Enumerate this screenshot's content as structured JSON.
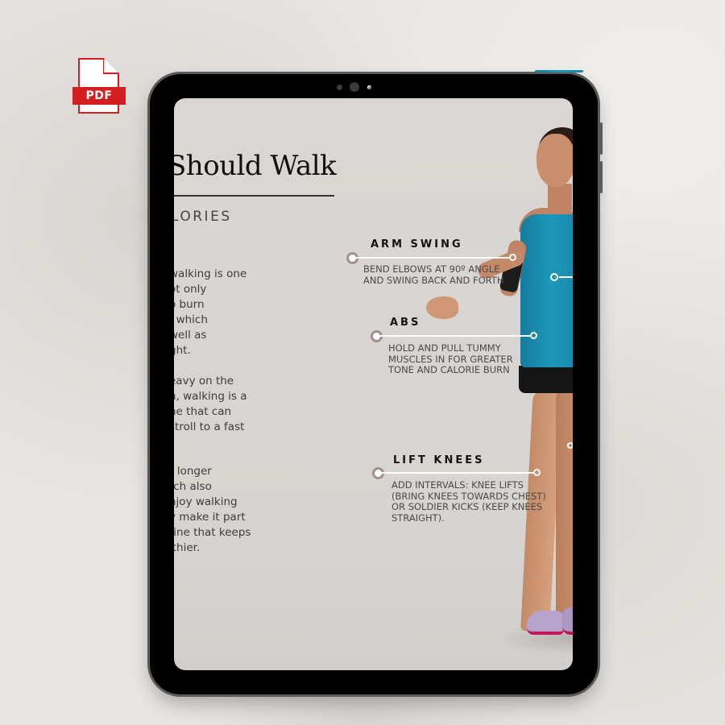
{
  "badge": {
    "label": "PDF",
    "color": "#d31f1f"
  },
  "page": {
    "title": "Should Walk",
    "subtitle": "LORIES",
    "paragraphs": [
      [
        "walking is one",
        "ot only",
        "o burn",
        ", which",
        "well as",
        "ght."
      ],
      [
        "eavy on the",
        "n, walking is a",
        "ne that can",
        "stroll to a fast"
      ],
      [
        "r longer",
        "rch also",
        "njoy walking",
        "y make it part",
        "tine that keeps",
        "lthier."
      ]
    ]
  },
  "callouts": [
    {
      "id": "arm-swing",
      "heading": "ARM SWING",
      "description": [
        "BEND ELBOWS AT 90º ANGLE",
        "AND SWING BACK AND FORTH"
      ]
    },
    {
      "id": "abs",
      "heading": "ABS",
      "description": [
        "HOLD AND PULL TUMMY",
        "MUSCLES IN FOR GREATER",
        "TONE AND CALORIE BURN"
      ]
    },
    {
      "id": "lift-knees",
      "heading": "LIFT KNEES",
      "description": [
        "ADD INTERVALS: KNEE LIFTS",
        "(BRING KNEES TOWARDS CHEST)",
        "OR SOLDIER KICKS (KEEP KNEES",
        "STRAIGHT)."
      ]
    }
  ],
  "colors": {
    "screen_bg": "#d9d5d2",
    "callout_anchor": "#a58f8c",
    "tank_top": "#1a8fb0"
  }
}
